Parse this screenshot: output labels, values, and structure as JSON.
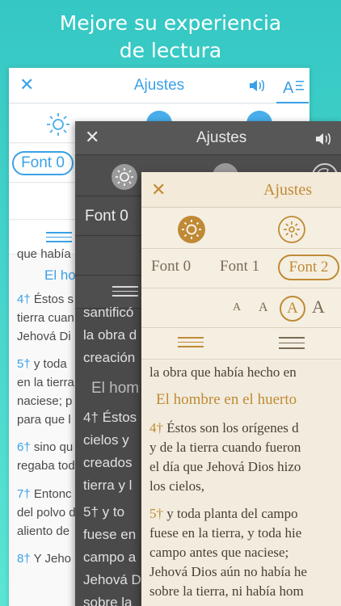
{
  "headline": {
    "line1": "Mejore su experiencia",
    "line2": "de lectura"
  },
  "panel_light": {
    "title": "Ajustes",
    "font_selected": "Font 0",
    "text_lines": [
      {
        "vn": "",
        "text": "que había"
      },
      {
        "vn": "",
        "text": "El hom"
      },
      {
        "vn": "4†",
        "text": " Éstos s"
      },
      {
        "vn": "",
        "text": "tierra cuan"
      },
      {
        "vn": "",
        "text": "Jehová Di"
      },
      {
        "vn": "5†",
        "text": " y toda"
      },
      {
        "vn": "",
        "text": "en la tierra"
      },
      {
        "vn": "",
        "text": "naciese; p"
      },
      {
        "vn": "",
        "text": "para que l"
      },
      {
        "vn": "6†",
        "text": " sino qu"
      },
      {
        "vn": "",
        "text": "regaba tod"
      },
      {
        "vn": "7†",
        "text": " Entonc"
      },
      {
        "vn": "",
        "text": "del polvo d"
      },
      {
        "vn": "",
        "text": "aliento de"
      },
      {
        "vn": "8†",
        "text": " Y Jeho"
      }
    ],
    "accent_color": "#3ba1e6"
  },
  "panel_dark": {
    "title": "Ajustes",
    "font_selected": "Font 0",
    "text_lines": [
      {
        "vn": "",
        "text": "santificó"
      },
      {
        "vn": "",
        "text": "la obra d"
      },
      {
        "vn": "",
        "text": "creación"
      },
      {
        "vn": "",
        "text": "El hom"
      },
      {
        "vn": "4†",
        "text": " Éstos"
      },
      {
        "vn": "",
        "text": "cielos y"
      },
      {
        "vn": "",
        "text": "creados"
      },
      {
        "vn": "",
        "text": "tierra y l"
      },
      {
        "vn": "5†",
        "text": " y to"
      },
      {
        "vn": "",
        "text": "fuese en"
      },
      {
        "vn": "",
        "text": "campo a"
      },
      {
        "vn": "",
        "text": "Jehová D"
      },
      {
        "vn": "",
        "text": "sobre la"
      }
    ]
  },
  "panel_sepia": {
    "title": "Ajustes",
    "fonts": [
      "Font 0",
      "Font 1",
      "Font 2"
    ],
    "font_selected": "Font 2",
    "sizes": [
      "A",
      "A",
      "A",
      "A"
    ],
    "text_lines": [
      {
        "vn": "",
        "text": "la obra que había hecho en"
      },
      {
        "vn": "",
        "text": "El hombre en el huerto"
      },
      {
        "vn": "4†",
        "text": " Éstos son los orígenes d"
      },
      {
        "vn": "",
        "text": "y de la tierra cuando fueron"
      },
      {
        "vn": "",
        "text": "el día que Jehová Dios hizo"
      },
      {
        "vn": "",
        "text": "los cielos,"
      },
      {
        "vn": "5†",
        "text": " y toda planta del campo"
      },
      {
        "vn": "",
        "text": "fuese en la tierra, y toda hie"
      },
      {
        "vn": "",
        "text": "campo antes que naciese;"
      },
      {
        "vn": "",
        "text": "Jehová Dios aún no había he"
      },
      {
        "vn": "",
        "text": "sobre la tierra, ni había hom"
      }
    ],
    "accent_color": "#c08a35"
  }
}
